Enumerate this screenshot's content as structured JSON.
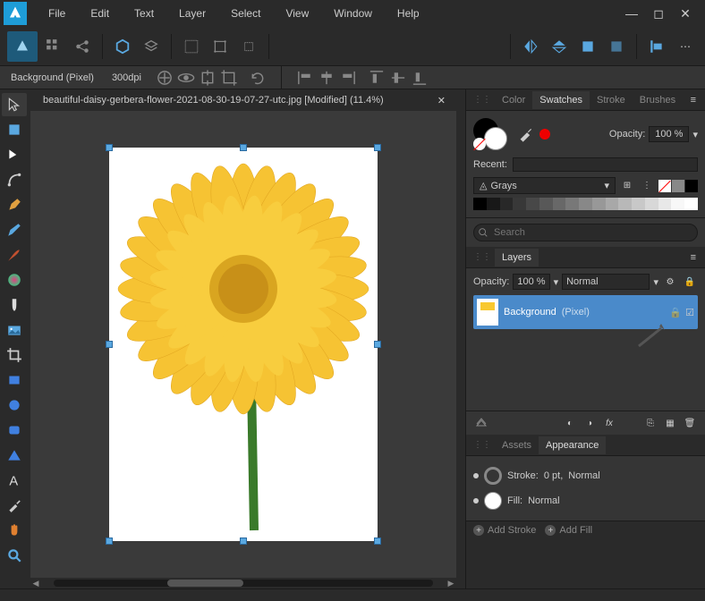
{
  "menu": [
    "File",
    "Edit",
    "Text",
    "Layer",
    "Select",
    "View",
    "Window",
    "Help"
  ],
  "context": {
    "layer_label": "Background (Pixel)",
    "dpi": "300dpi"
  },
  "tab": {
    "title": "beautiful-daisy-gerbera-flower-2021-08-30-19-07-27-utc.jpg [Modified] (11.4%)"
  },
  "color_panel": {
    "tabs": [
      "Color",
      "Swatches",
      "Stroke",
      "Brushes"
    ],
    "active_tab": "Swatches",
    "opacity_label": "Opacity:",
    "opacity_value": "100 %",
    "recent_label": "Recent:",
    "palette_name": "Grays",
    "preset_colors": [
      "#ffffff",
      "#e03030",
      "#808080",
      "#000000"
    ],
    "gray_shades": [
      "#000000",
      "#181818",
      "#282828",
      "#383838",
      "#484848",
      "#585858",
      "#686868",
      "#787878",
      "#888888",
      "#989898",
      "#a8a8a8",
      "#b8b8b8",
      "#c8c8c8",
      "#d8d8d8",
      "#e8e8e8",
      "#f8f8f8",
      "#ffffff"
    ]
  },
  "search_placeholder": "Search",
  "layers_panel": {
    "tab": "Layers",
    "opacity_label": "Opacity:",
    "opacity_value": "100 %",
    "blend_mode": "Normal",
    "layer_name": "Background",
    "layer_type": "(Pixel)"
  },
  "assets_panel": {
    "tabs": [
      "Assets",
      "Appearance"
    ],
    "active_tab": "Appearance",
    "stroke_label": "Stroke:",
    "stroke_value": "0 pt,",
    "stroke_blend": "Normal",
    "fill_label": "Fill:",
    "fill_blend": "Normal",
    "add_stroke": "Add Stroke",
    "add_fill": "Add Fill"
  }
}
